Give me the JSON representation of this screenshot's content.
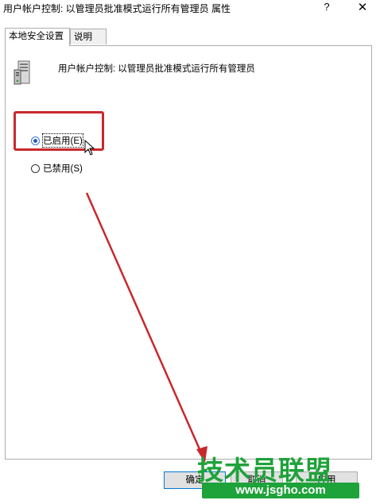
{
  "window": {
    "title": "用户帐户控制: 以管理员批准模式运行所有管理员 属性",
    "help_glyph": "?",
    "close_glyph": "✕"
  },
  "tabs": [
    {
      "label": "本地安全设置",
      "selected": true
    },
    {
      "label": "说明",
      "selected": false
    }
  ],
  "policy": {
    "icon": "server-icon",
    "name": "用户帐户控制: 以管理员批准模式运行所有管理员"
  },
  "options": [
    {
      "label": "已启用(E)",
      "checked": true
    },
    {
      "label": "已禁用(S)",
      "checked": false
    }
  ],
  "buttons": {
    "ok": "确定",
    "cancel": "取消",
    "apply": "应用"
  },
  "watermark": {
    "text": "技术员联盟",
    "url": "www.jsgho.com"
  },
  "colors": {
    "annotation_red": "#c8282c",
    "watermark_green": "#1ea23a",
    "radio_blue": "#1e5fb8"
  }
}
